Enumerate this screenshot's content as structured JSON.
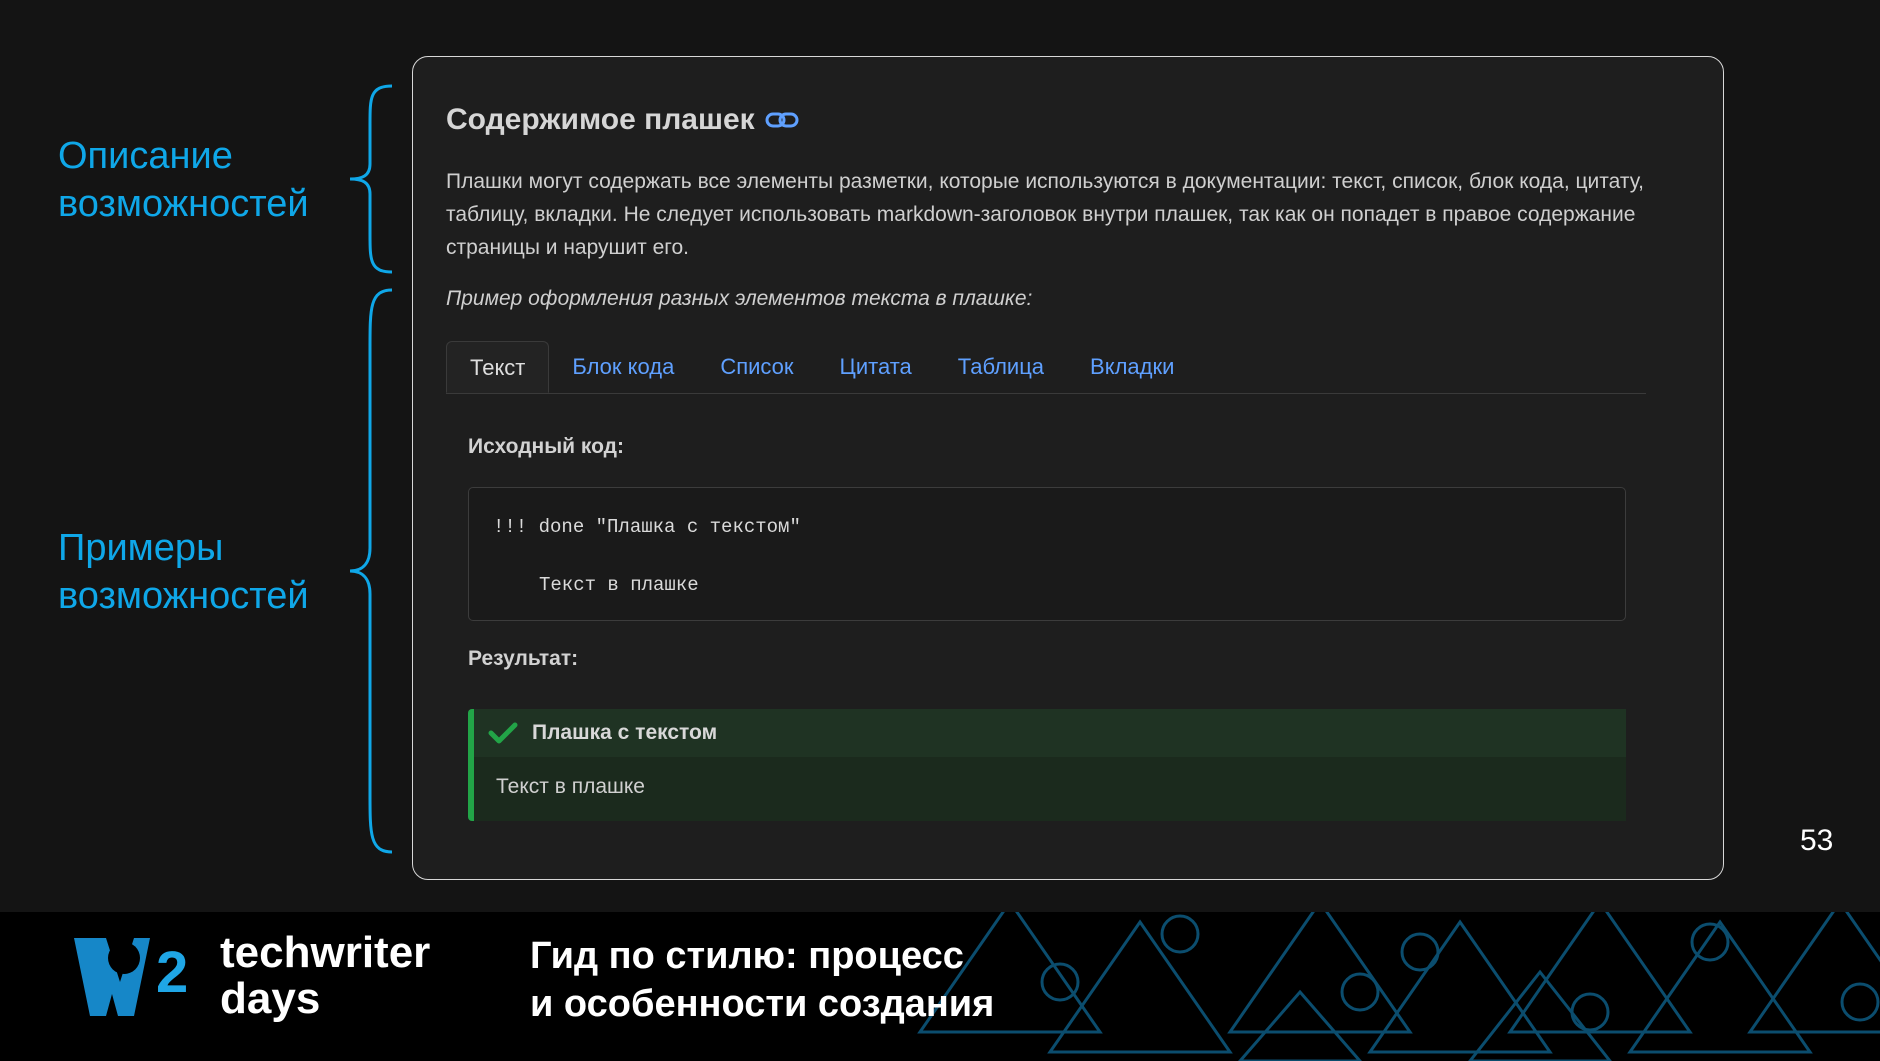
{
  "annotations": {
    "description_label": "Описание\nвозможностей",
    "description_line1": "Описание",
    "description_line2": "возможностей",
    "examples_line1": "Примеры",
    "examples_line2": "возможностей"
  },
  "card": {
    "title": "Содержимое плашек",
    "description": "Плашки могут содержать все элементы разметки, которые используются в документации: текст, список, блок кода, цитату, таблицу, вкладки. Не следует использовать markdown-заголовок внутри плашек, так как он попадет в правое содержание страницы и нарушит его.",
    "example_label": "Пример оформления разных элементов текста в плашке:",
    "tabs": [
      {
        "label": "Текст",
        "active": true
      },
      {
        "label": "Блок кода",
        "active": false
      },
      {
        "label": "Список",
        "active": false
      },
      {
        "label": "Цитата",
        "active": false
      },
      {
        "label": "Таблица",
        "active": false
      },
      {
        "label": "Вкладки",
        "active": false
      }
    ],
    "source_label": "Исходный код:",
    "code_line1": "!!! done \"Плашка с текстом\"",
    "code_line2": "Текст в плашке",
    "result_label": "Результат:",
    "admonition": {
      "title": "Плашка с текстом",
      "body": "Текст в плашке",
      "icon": "checkmark-icon",
      "color": "#22a447"
    }
  },
  "page_number": "53",
  "footer": {
    "brand_line1": "techwriter",
    "brand_line2": "days",
    "logo_number": "2",
    "talk_line1": "Гид по стилю: процесс",
    "talk_line2": "и особенности создания"
  },
  "colors": {
    "accent_blue": "#0fa7e8",
    "link_blue": "#5fa0ff",
    "success_green": "#22a447"
  }
}
